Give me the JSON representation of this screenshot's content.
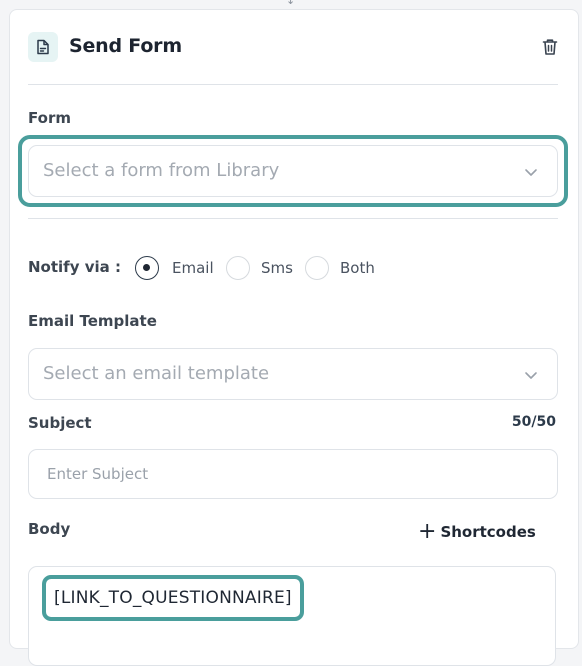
{
  "header": {
    "title": "Send Form",
    "icon": "form-document-icon",
    "delete_icon": "trash-icon"
  },
  "form_field": {
    "label": "Form",
    "placeholder": "Select a form from Library",
    "highlighted": true
  },
  "notify": {
    "label": "Notify via :",
    "options": [
      {
        "label": "Email",
        "selected": true
      },
      {
        "label": "Sms",
        "selected": false
      },
      {
        "label": "Both",
        "selected": false
      }
    ]
  },
  "email_template": {
    "label": "Email Template",
    "placeholder": "Select an email template"
  },
  "subject": {
    "label": "Subject",
    "counter": "50/50",
    "placeholder": "Enter Subject",
    "value": ""
  },
  "body": {
    "label": "Body",
    "shortcodes_label": "Shortcodes",
    "token": "[LINK_TO_QUESTIONNAIRE]"
  },
  "colors": {
    "accent": "#4a9e9c",
    "text": "#1f2733",
    "placeholder": "#a4aab2",
    "border": "#dfe3e8"
  }
}
